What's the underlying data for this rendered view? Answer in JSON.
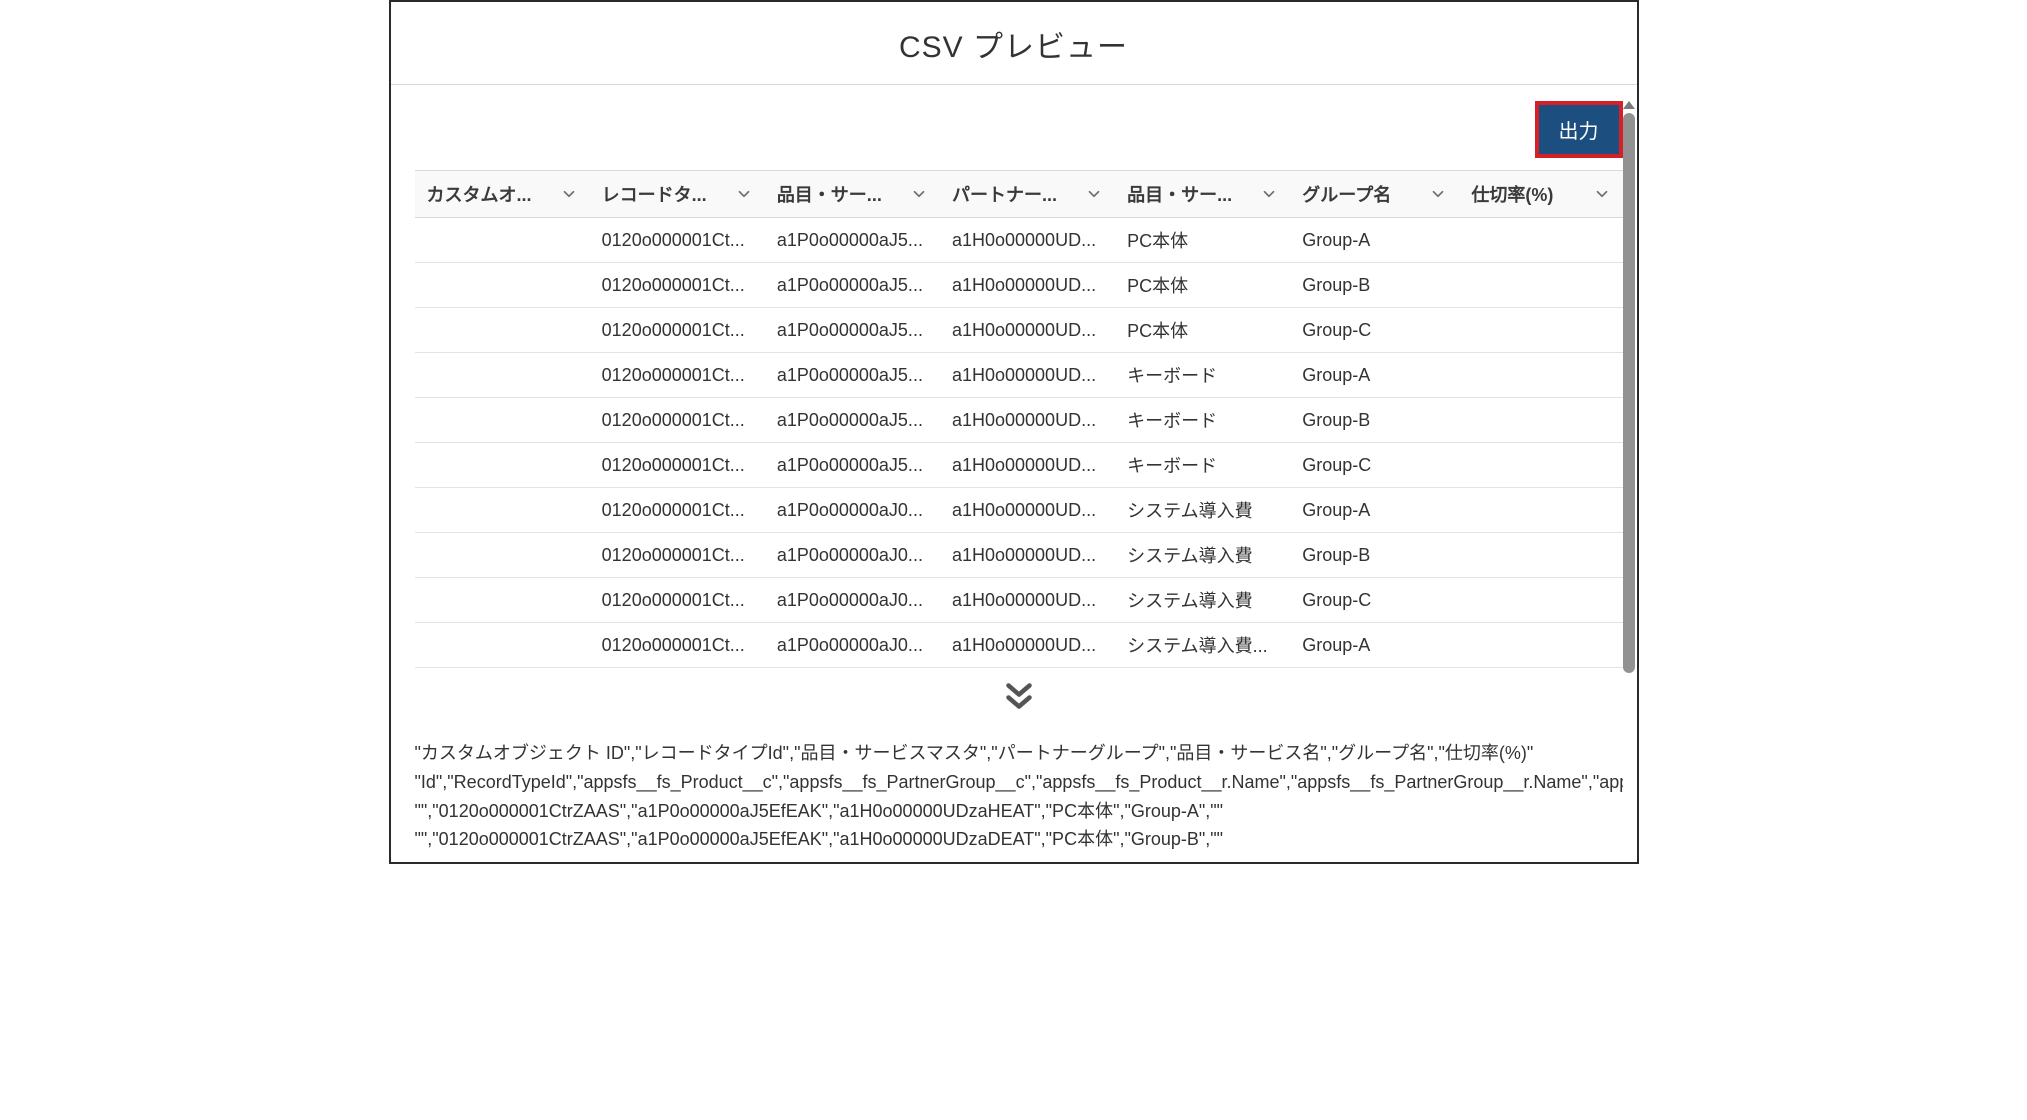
{
  "modal": {
    "title": "CSV プレビュー"
  },
  "actions": {
    "export_label": "出力"
  },
  "table": {
    "columns": [
      {
        "label": "カスタムオ..."
      },
      {
        "label": "レコードタ..."
      },
      {
        "label": "品目・サー..."
      },
      {
        "label": "パートナー..."
      },
      {
        "label": "品目・サー..."
      },
      {
        "label": "グループ名"
      },
      {
        "label": "仕切率(%)"
      }
    ],
    "rows": [
      {
        "c0": "",
        "c1": "0120o000001Ct...",
        "c2": "a1P0o00000aJ5...",
        "c3": "a1H0o00000UD...",
        "c4": "PC本体",
        "c5": "Group-A",
        "c6": ""
      },
      {
        "c0": "",
        "c1": "0120o000001Ct...",
        "c2": "a1P0o00000aJ5...",
        "c3": "a1H0o00000UD...",
        "c4": "PC本体",
        "c5": "Group-B",
        "c6": ""
      },
      {
        "c0": "",
        "c1": "0120o000001Ct...",
        "c2": "a1P0o00000aJ5...",
        "c3": "a1H0o00000UD...",
        "c4": "PC本体",
        "c5": "Group-C",
        "c6": ""
      },
      {
        "c0": "",
        "c1": "0120o000001Ct...",
        "c2": "a1P0o00000aJ5...",
        "c3": "a1H0o00000UD...",
        "c4": "キーボード",
        "c5": "Group-A",
        "c6": ""
      },
      {
        "c0": "",
        "c1": "0120o000001Ct...",
        "c2": "a1P0o00000aJ5...",
        "c3": "a1H0o00000UD...",
        "c4": "キーボード",
        "c5": "Group-B",
        "c6": ""
      },
      {
        "c0": "",
        "c1": "0120o000001Ct...",
        "c2": "a1P0o00000aJ5...",
        "c3": "a1H0o00000UD...",
        "c4": "キーボード",
        "c5": "Group-C",
        "c6": ""
      },
      {
        "c0": "",
        "c1": "0120o000001Ct...",
        "c2": "a1P0o00000aJ0...",
        "c3": "a1H0o00000UD...",
        "c4": "システム導入費",
        "c5": "Group-A",
        "c6": ""
      },
      {
        "c0": "",
        "c1": "0120o000001Ct...",
        "c2": "a1P0o00000aJ0...",
        "c3": "a1H0o00000UD...",
        "c4": "システム導入費",
        "c5": "Group-B",
        "c6": ""
      },
      {
        "c0": "",
        "c1": "0120o000001Ct...",
        "c2": "a1P0o00000aJ0...",
        "c3": "a1H0o00000UD...",
        "c4": "システム導入費",
        "c5": "Group-C",
        "c6": ""
      },
      {
        "c0": "",
        "c1": "0120o000001Ct...",
        "c2": "a1P0o00000aJ0...",
        "c3": "a1H0o00000UD...",
        "c4": "システム導入費...",
        "c5": "Group-A",
        "c6": ""
      }
    ]
  },
  "raw_csv": {
    "lines": [
      "\"カスタムオブジェクト ID\",\"レコードタイプId\",\"品目・サービスマスタ\",\"パートナーグループ\",\"品目・サービス名\",\"グループ名\",\"仕切率(%)\"",
      "\"Id\",\"RecordTypeId\",\"appsfs__fs_Product__c\",\"appsfs__fs_PartnerGroup__c\",\"appsfs__fs_Product__r.Name\",\"appsfs__fs_PartnerGroup__r.Name\",\"appsfs",
      "\"\",\"0120o000001CtrZAAS\",\"a1P0o00000aJ5EfEAK\",\"a1H0o00000UDzaHEAT\",\"PC本体\",\"Group-A\",\"\"",
      "\"\",\"0120o000001CtrZAAS\",\"a1P0o00000aJ5EfEAK\",\"a1H0o00000UDzaDEAT\",\"PC本体\",\"Group-B\",\"\""
    ]
  }
}
